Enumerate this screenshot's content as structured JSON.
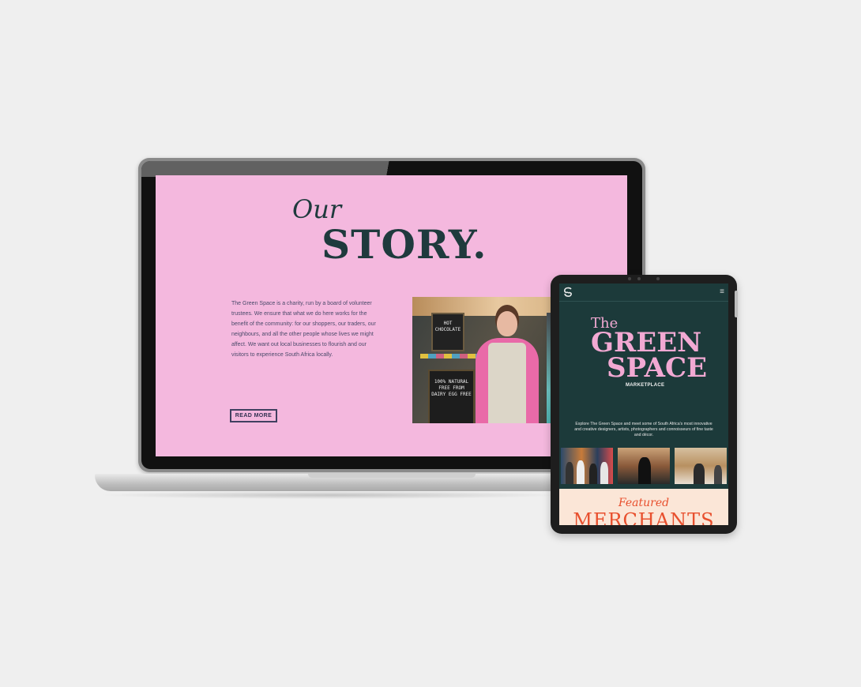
{
  "laptop_page": {
    "heading_small": "Our",
    "heading_large": "STORY.",
    "body": "The Green Space is a charity, run by a board of volunteer trustees. We ensure that what we do here works for the benefit of the community: for our shoppers, our traders, our neighbours, and all the other people whose lives we might affect. We want out local businesses to flourish and our visitors to experience South Africa locally.",
    "button_label": "READ MORE",
    "photo_board1": "HOT CHOCOLATE",
    "photo_board2": "100% NATURAL FREE FROM DAIRY EGG FREE"
  },
  "tablet_page": {
    "menu_icon": "≡",
    "title_the": "The",
    "title_green": "GREEN",
    "title_space": "SPACE",
    "subtitle": "MARKETPLACE",
    "intro": "Explore The Green Space and meet some of South Africa's most innovative and creative designers, artists, photographers and connoisseurs of fine taste and décor.",
    "featured_small": "Featured",
    "featured_large": "MERCHANTS"
  },
  "colors": {
    "laptop_background": "#f4b8de",
    "heading_dark": "#1f3a3d",
    "tablet_background": "#1c3a3a",
    "tablet_accent_pink": "#f2a9d3",
    "featured_orange": "#e8502e",
    "featured_background": "#fbe6d7"
  },
  "icons": [
    "logo-icon",
    "hamburger-menu-icon"
  ]
}
